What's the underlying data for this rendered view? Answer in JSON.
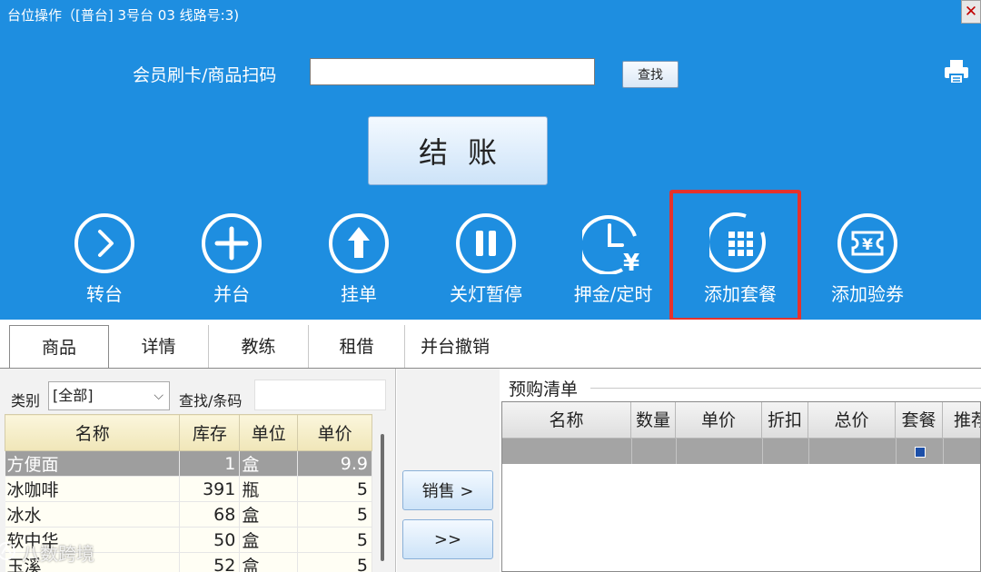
{
  "window": {
    "title": "台位操作（[普台] 3号台 03  线路号:3)",
    "close_label": "✕"
  },
  "scan": {
    "label": "会员刷卡/商品扫码",
    "value": "",
    "find_label": "查找"
  },
  "checkout_label": "结账",
  "actions": [
    {
      "label": "转台",
      "icon": "chevron-right-icon"
    },
    {
      "label": "并台",
      "icon": "plus-icon"
    },
    {
      "label": "挂单",
      "icon": "arrow-up-icon"
    },
    {
      "label": "关灯暂停",
      "icon": "pause-icon"
    },
    {
      "label": "押金/定时",
      "icon": "clock-yen-icon"
    },
    {
      "label": "添加套餐",
      "icon": "grid-icon",
      "highlighted": true
    },
    {
      "label": "添加验券",
      "icon": "ticket-yen-icon"
    }
  ],
  "tabs": [
    {
      "label": "商品",
      "active": true
    },
    {
      "label": "详情"
    },
    {
      "label": "教练"
    },
    {
      "label": "租借"
    },
    {
      "label": "并台撤销"
    }
  ],
  "goods": {
    "category_label": "类别",
    "category_value": "[全部]",
    "search_label": "查找/条码",
    "columns": [
      "名称",
      "库存",
      "单位",
      "单价"
    ],
    "rows": [
      {
        "name": "方便面",
        "stock": "1",
        "unit": "盒",
        "price": "9.9",
        "selected": true
      },
      {
        "name": "冰咖啡",
        "stock": "391",
        "unit": "瓶",
        "price": "5"
      },
      {
        "name": "冰水",
        "stock": "68",
        "unit": "盒",
        "price": "5"
      },
      {
        "name": "软中华",
        "stock": "50",
        "unit": "盒",
        "price": "5"
      },
      {
        "name": "玉溪",
        "stock": "52",
        "unit": "盒",
        "price": "5"
      }
    ]
  },
  "middle": {
    "sell_label": "销售 >",
    "sell_all_label": ">>"
  },
  "preorder": {
    "title": "预购清单",
    "columns": [
      "名称",
      "数量",
      "单价",
      "折扣",
      "总价",
      "套餐",
      "推荐"
    ]
  },
  "watermark": "八数跨境",
  "colors": {
    "panel_blue": "#1e8ee0",
    "highlight_red": "#e5322c"
  }
}
